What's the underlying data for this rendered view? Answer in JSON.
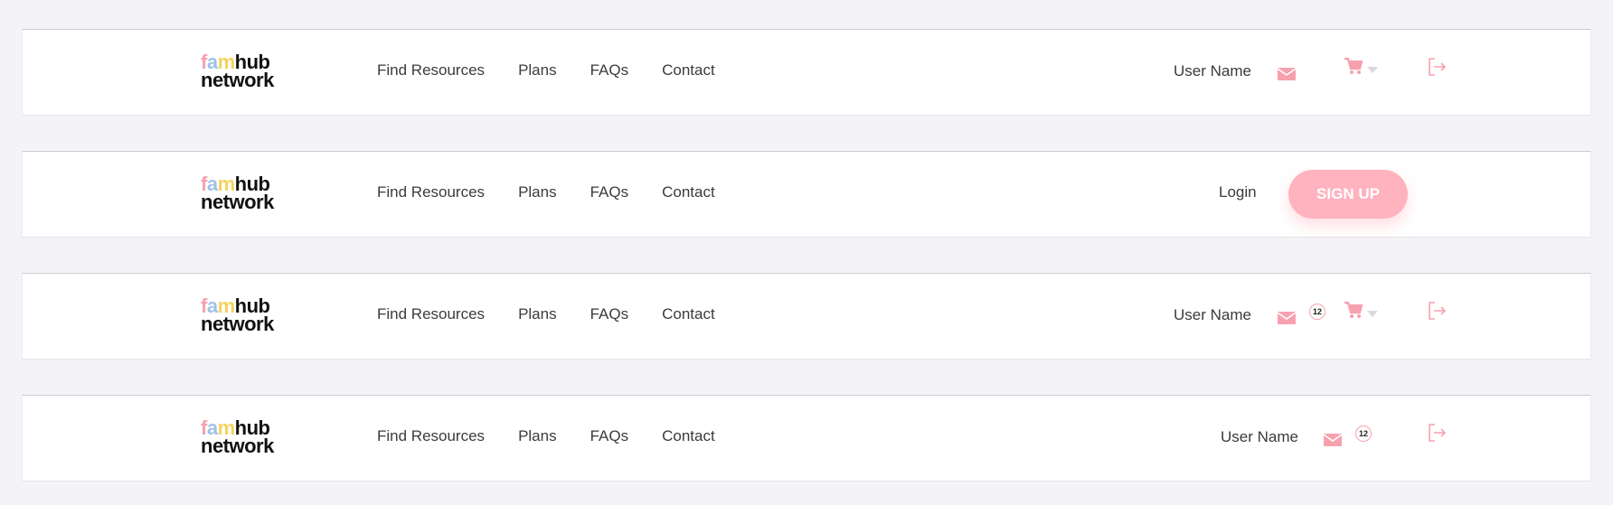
{
  "brand": {
    "logo_line1_a": "f",
    "logo_line1_b": "a",
    "logo_line1_c": "m",
    "logo_line1_d": "hub",
    "logo_line2": "network"
  },
  "nav": {
    "items": [
      "Find Resources",
      "Plans",
      "FAQs",
      "Contact"
    ]
  },
  "headers": [
    {
      "variant": "logged-in-cart",
      "user_name": "User Name"
    },
    {
      "variant": "logged-out",
      "login_label": "Login",
      "signup_label": "SIGN UP"
    },
    {
      "variant": "logged-in-cart-badge",
      "user_name": "User Name",
      "mail_badge": "12"
    },
    {
      "variant": "logged-in-badge",
      "user_name": "User Name",
      "mail_badge": "12"
    }
  ],
  "icons": {
    "mail": "mail-icon",
    "cart": "cart-icon",
    "caret": "caret-down-icon",
    "logout": "logout-icon"
  },
  "colors": {
    "accent_pink": "#f7a1ae",
    "signup_bg": "#ffb3be",
    "text": "#3b3b3b",
    "page_bg": "#f4f4f8"
  }
}
